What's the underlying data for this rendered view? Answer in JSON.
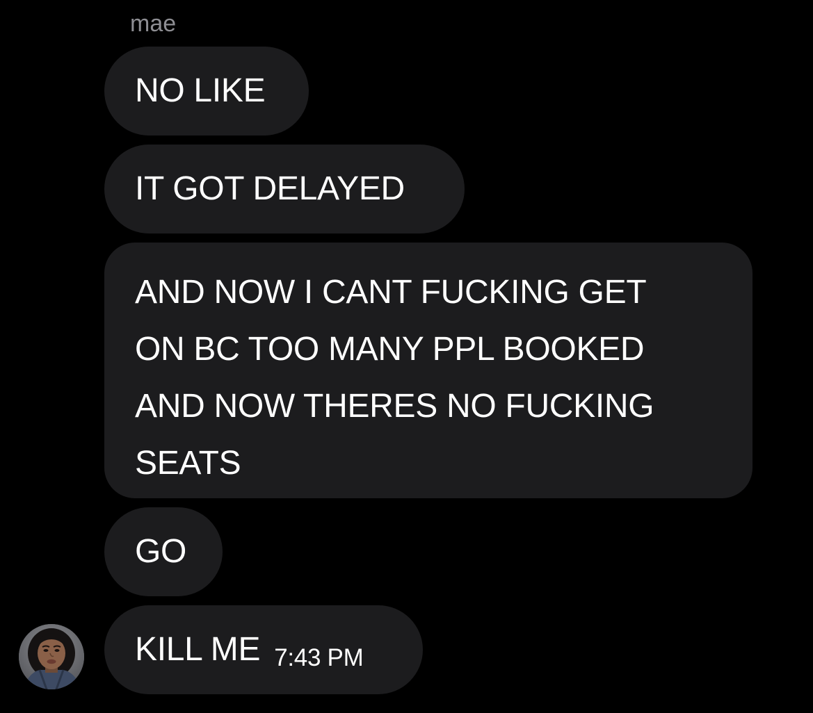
{
  "conversation": {
    "sender_name": "mae",
    "messages": [
      {
        "lines": [
          "NO LIKE"
        ]
      },
      {
        "lines": [
          "IT GOT DELAYED"
        ]
      },
      {
        "lines": [
          "AND NOW I CANT FUCKING GET",
          "ON BC TOO MANY PPL BOOKED",
          "AND NOW THERES NO FUCKING",
          "SEATS"
        ]
      },
      {
        "lines": [
          "GO"
        ]
      },
      {
        "lines": [
          "KILL ME"
        ],
        "timestamp": "7:43 PM"
      }
    ]
  },
  "colors": {
    "background": "#000000",
    "bubble": "#1c1c1e",
    "sender_name": "#8e8e93",
    "text": "#ffffff"
  },
  "icons": {
    "avatar": "profile-photo"
  }
}
